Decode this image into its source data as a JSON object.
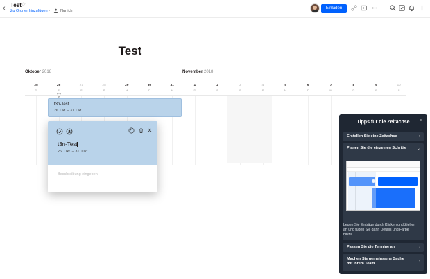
{
  "header": {
    "back_icon": "chevron-left-icon",
    "title": "Test",
    "star_icon": "star-icon",
    "folder_link": "Zu Ordner hinzufügen",
    "separator": "•",
    "owner": "Nur ich",
    "invite_label": "Einladen",
    "icons": [
      "link-icon",
      "present-icon",
      "more-icon",
      "search-icon",
      "checklist-icon",
      "bell-icon",
      "plus-icon"
    ]
  },
  "page": {
    "title": "Test"
  },
  "timeline": {
    "months": [
      {
        "name": "Oktober",
        "year": "2018"
      },
      {
        "name": "November",
        "year": "2018"
      }
    ],
    "days": [
      {
        "n": "25",
        "w": "D",
        "faded": false
      },
      {
        "n": "26",
        "w": "F",
        "faded": false
      },
      {
        "n": "27",
        "w": "S",
        "faded": true
      },
      {
        "n": "28",
        "w": "S",
        "faded": true
      },
      {
        "n": "29",
        "w": "M",
        "faded": false
      },
      {
        "n": "30",
        "w": "D",
        "faded": false
      },
      {
        "n": "31",
        "w": "M",
        "faded": false
      },
      {
        "n": "1",
        "w": "D",
        "faded": false
      },
      {
        "n": "2",
        "w": "F",
        "faded": false
      },
      {
        "n": "3",
        "w": "S",
        "faded": true
      },
      {
        "n": "4",
        "w": "S",
        "faded": true
      },
      {
        "n": "5",
        "w": "M",
        "faded": false
      },
      {
        "n": "6",
        "w": "D",
        "faded": false
      },
      {
        "n": "7",
        "w": "M",
        "faded": false
      },
      {
        "n": "8",
        "w": "D",
        "faded": false
      },
      {
        "n": "9",
        "w": "F",
        "faded": false
      },
      {
        "n": "10",
        "w": "S",
        "faded": true
      }
    ],
    "entry": {
      "title": "t3n-Test",
      "dates": "26. Okt. – 31. Okt.",
      "color": "#b9d3ea"
    }
  },
  "popup": {
    "icons": [
      "check-circle-icon",
      "add-person-icon",
      "palette-icon",
      "trash-icon",
      "close-icon"
    ],
    "title": "t3n-Test",
    "dates": "26. Okt. – 31. Okt.",
    "description_placeholder": "Beschreibung eingeben"
  },
  "tips": {
    "title": "Tipps für die Zeitachse",
    "close": "×",
    "items": [
      {
        "label": "Erstellen Sie eine Zeitachse",
        "chevron": "›"
      },
      {
        "label": "Planen Sie die einzelnen Schritte",
        "chevron": "⌄"
      },
      {
        "label": "Passen Sie die Termine an",
        "chevron": "›"
      },
      {
        "label": "Machen Sie gemeinsame Sache mit Ihrem Team",
        "chevron": "›"
      }
    ],
    "body": "Legen Sie Einträge durch Klicken und Ziehen an und fügen Sie dann Details und Farbe hinzu.",
    "accent": "#1f2733"
  }
}
